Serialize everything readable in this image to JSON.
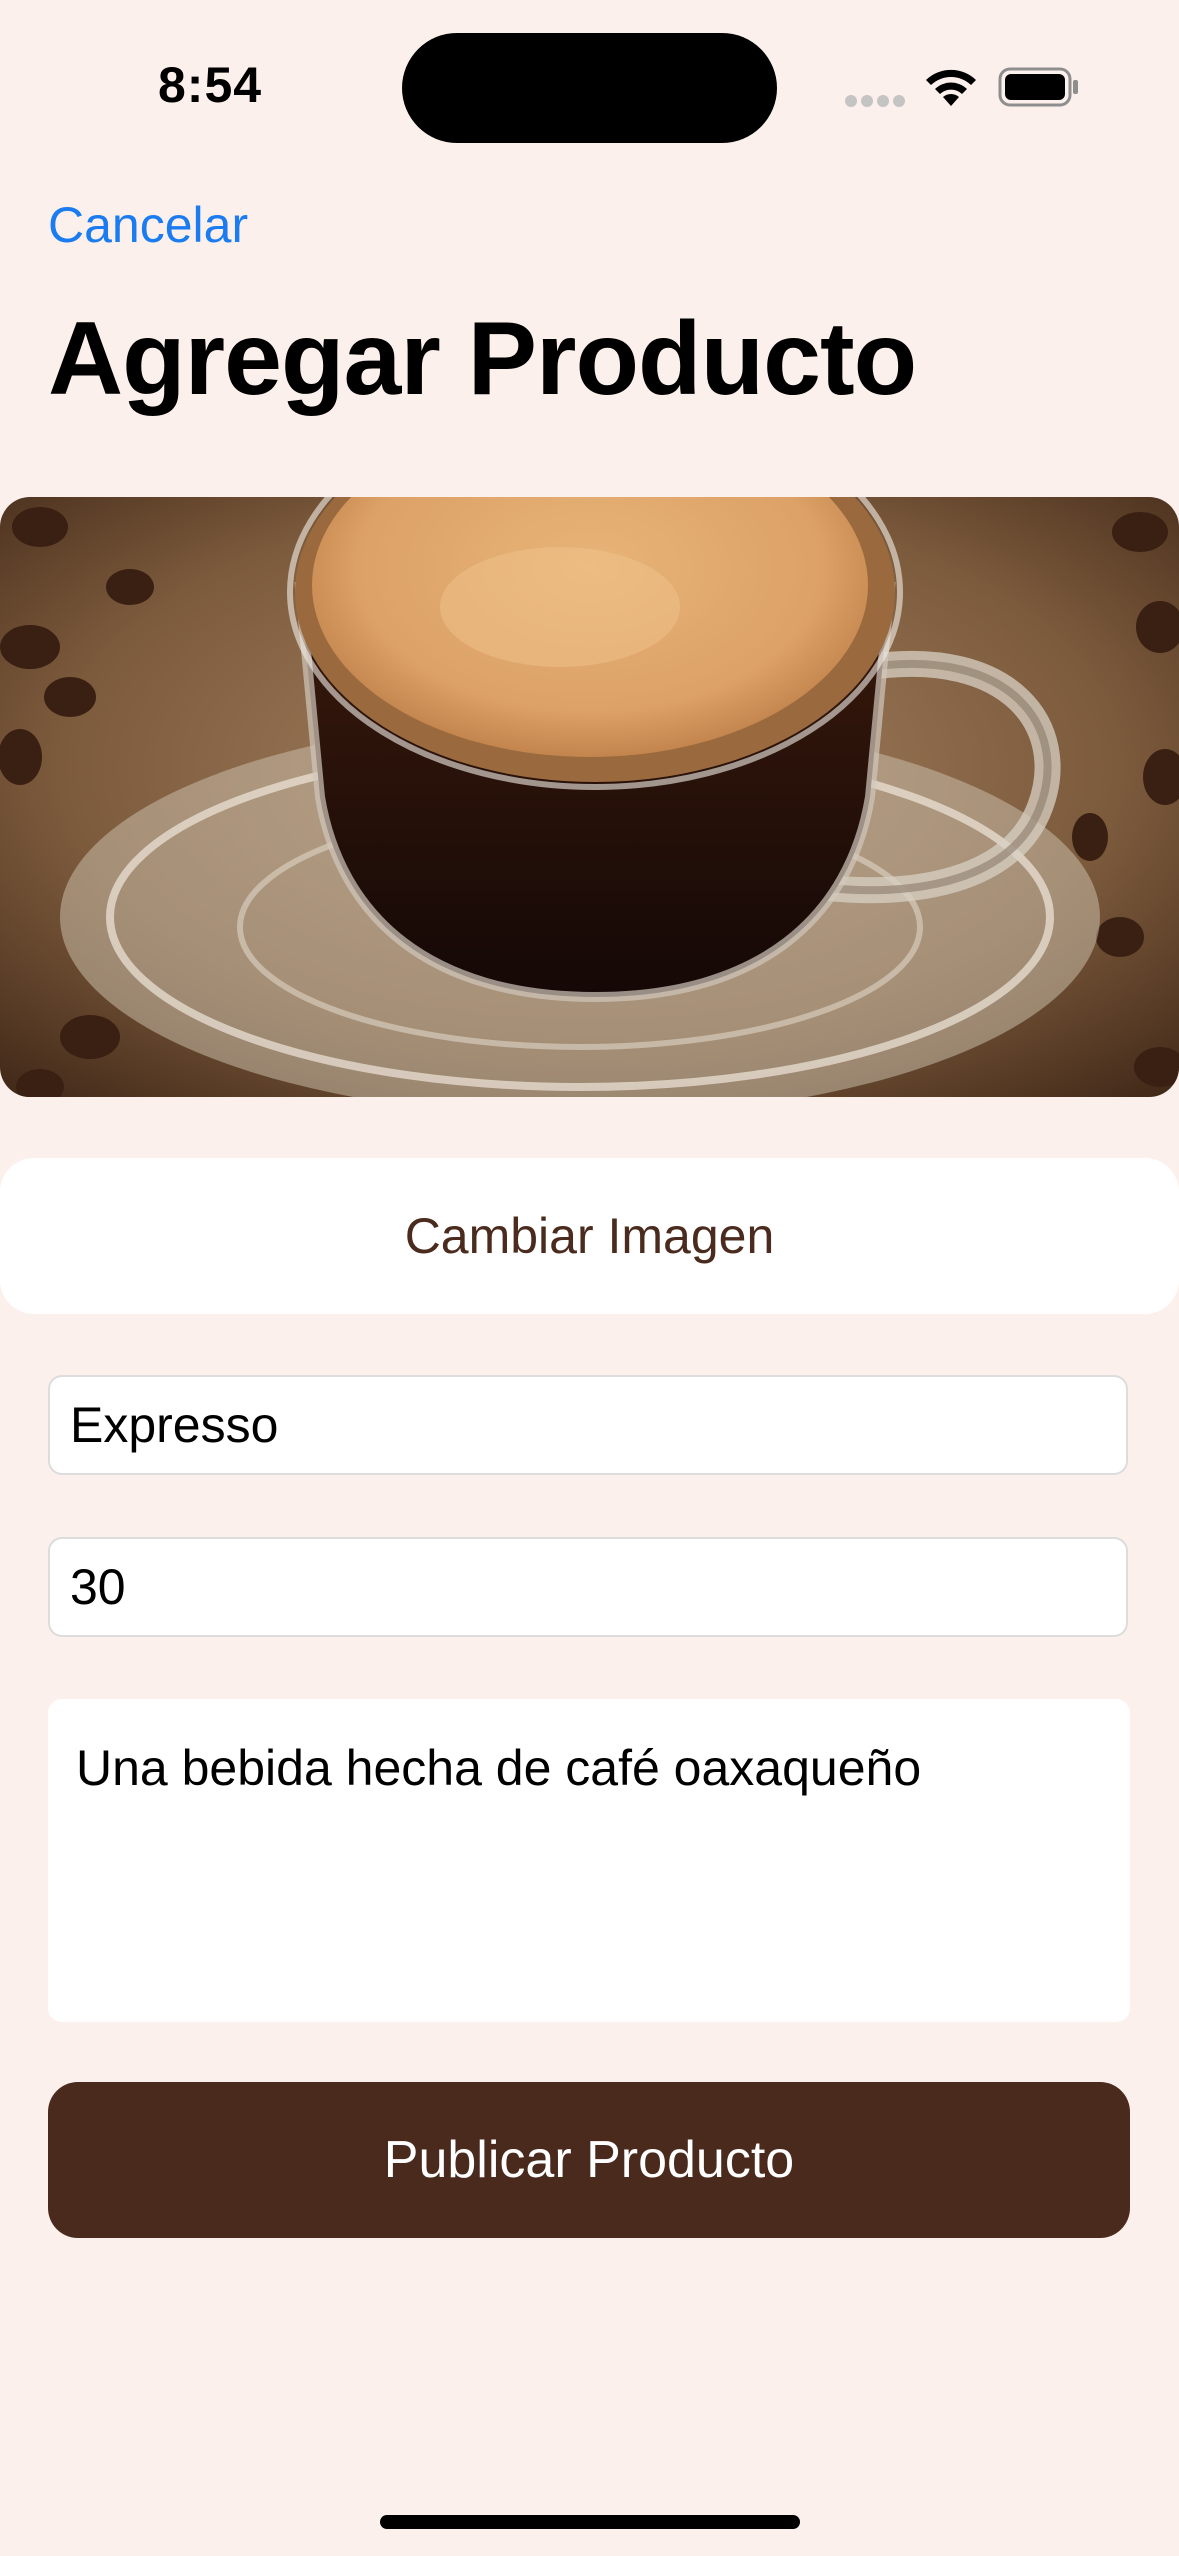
{
  "status_bar": {
    "time": "8:54"
  },
  "header": {
    "cancel_label": "Cancelar",
    "title": "Agregar Producto"
  },
  "product_image": {
    "icon": "espresso-cup-photo"
  },
  "actions": {
    "change_image_label": "Cambiar Imagen",
    "publish_label": "Publicar Producto"
  },
  "form": {
    "name_value": "Expresso",
    "price_value": "30",
    "description_value": "Una bebida hecha de café oaxaqueño"
  },
  "colors": {
    "background": "#fcf0ec",
    "accent_link": "#1a7cf0",
    "brand_brown": "#4a2a1d"
  }
}
